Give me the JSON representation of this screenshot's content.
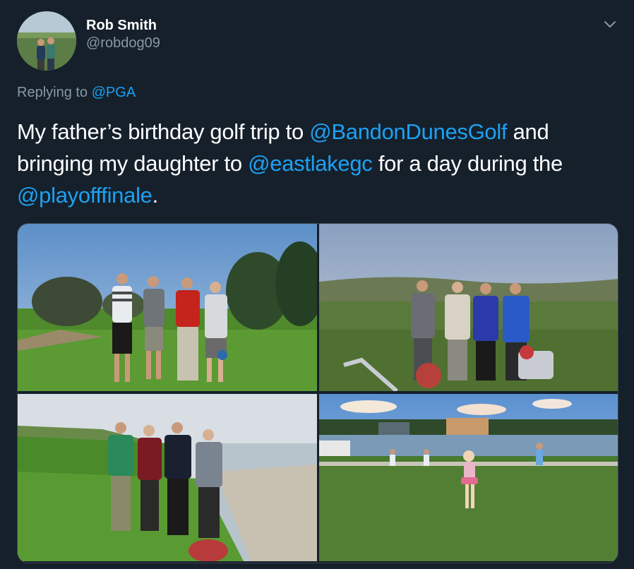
{
  "author": {
    "display_name": "Rob Smith",
    "handle": "@robdog09"
  },
  "reply": {
    "prefix": "Replying to ",
    "mention": "@PGA"
  },
  "tweet": {
    "t1": "My father’s birthday golf trip to ",
    "m1": "@BandonDunesGolf",
    "t2": " and bringing my daughter to ",
    "m2": "@eastlakegc",
    "t3": " for a day during the ",
    "m3": "@playofffinale",
    "t4": "."
  },
  "icons": {
    "caret": "chevron-down-icon"
  },
  "colors": {
    "background": "#15202b",
    "link": "#1da1f2",
    "secondary_text": "#8899a6"
  }
}
